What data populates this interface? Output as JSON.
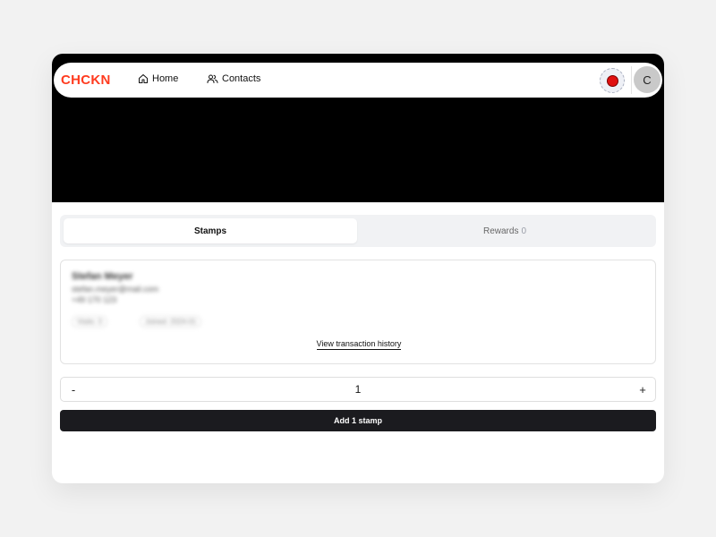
{
  "colors": {
    "brand": "#ff3b1f",
    "record": "#e01010",
    "primary_button": "#1b1b1f"
  },
  "header": {
    "logo": "CHCKN",
    "nav": [
      {
        "label": "Home",
        "icon": "home-icon"
      },
      {
        "label": "Contacts",
        "icon": "users-icon"
      }
    ],
    "record_icon": "record-icon",
    "avatar_initial": "C"
  },
  "tabs": [
    {
      "label": "Stamps",
      "active": true
    },
    {
      "label": "Rewards",
      "count": "0",
      "active": false
    }
  ],
  "customer": {
    "name": "Stefan Meyer",
    "line1": "stefan.meyer@mail.com",
    "line2": "+49 170 123",
    "tags": [
      "Visits: 3",
      "Joined: 2024-01"
    ]
  },
  "history_link": "View transaction history",
  "stepper": {
    "minus": "-",
    "value": "1",
    "plus": "+"
  },
  "add_button": "Add 1 stamp"
}
